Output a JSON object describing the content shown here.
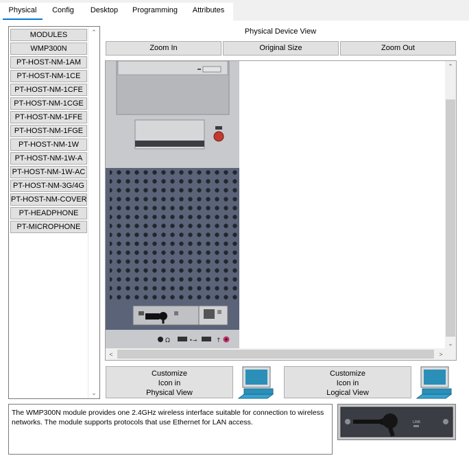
{
  "tabs": [
    {
      "label": "Physical",
      "active": true
    },
    {
      "label": "Config"
    },
    {
      "label": "Desktop"
    },
    {
      "label": "Programming"
    },
    {
      "label": "Attributes"
    }
  ],
  "modules": {
    "header": "MODULES",
    "items": [
      "WMP300N",
      "PT-HOST-NM-1AM",
      "PT-HOST-NM-1CE",
      "PT-HOST-NM-1CFE",
      "PT-HOST-NM-1CGE",
      "PT-HOST-NM-1FFE",
      "PT-HOST-NM-1FGE",
      "PT-HOST-NM-1W",
      "PT-HOST-NM-1W-A",
      "PT-HOST-NM-1W-AC",
      "PT-HOST-NM-3G/4G",
      "PT-HOST-NM-COVER",
      "PT-HEADPHONE",
      "PT-MICROPHONE"
    ]
  },
  "physical_view": {
    "title": "Physical Device View",
    "zoom_in": "Zoom In",
    "original_size": "Original Size",
    "zoom_out": "Zoom Out"
  },
  "customize": {
    "physical": {
      "line1": "Customize",
      "line2": "Icon in",
      "line3": "Physical View"
    },
    "logical": {
      "line1": "Customize",
      "line2": "Icon in",
      "line3": "Logical View"
    }
  },
  "description": "The WMP300N module provides one 2.4GHz wireless interface suitable for connection to wireless networks. The module supports protocols that use Ethernet for LAN access.",
  "module_image_label": "LINK",
  "colors": {
    "accent": "#0078d7",
    "button_bg": "#e1e1e1",
    "panel_bg": "#f0f0f0"
  }
}
